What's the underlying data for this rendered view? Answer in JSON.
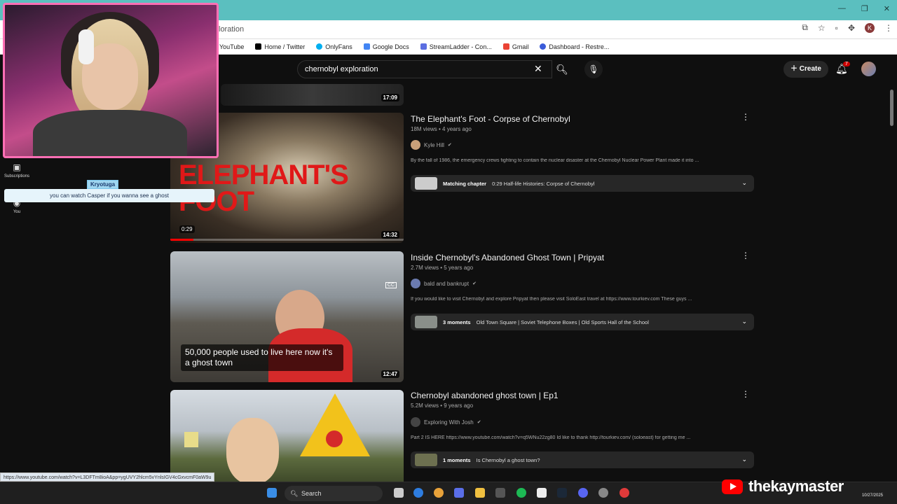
{
  "browser": {
    "url_partial": "loration",
    "bookmarks": [
      {
        "label": "YouTube",
        "color": "#ff0000"
      },
      {
        "label": "Home / Twitter",
        "color": "#000000"
      },
      {
        "label": "OnlyFans",
        "color": "#00aff0"
      },
      {
        "label": "Google Docs",
        "color": "#4285f4"
      },
      {
        "label": "StreamLadder - Con...",
        "color": "#5b6ee1"
      },
      {
        "label": "Gmail",
        "color": "#ea4335"
      },
      {
        "label": "Dashboard - Restre...",
        "color": "#3a5bd9"
      }
    ],
    "profile_initial": "K"
  },
  "header": {
    "search_value": "chernobyl exploration",
    "create_label": "Create",
    "notif_count": "7"
  },
  "sidebar": [
    {
      "label": "Subscriptions",
      "icon": "subscriptions-icon"
    },
    {
      "label": "You",
      "icon": "you-icon"
    }
  ],
  "overlay": {
    "chat_user": "Kryotuga",
    "chat_message": "you can watch Casper if you wanna see a ghost"
  },
  "results": [
    {
      "title": "The Elephant's Foot - Corpse of Chernobyl",
      "meta": "18M views • 4 years ago",
      "channel": "Kyle Hill",
      "desc": "By the fall of 1986, the emergency crews fighting to contain the nuclear disaster at the Chernobyl Nuclear Power Plant made it into ...",
      "chapter_label": "Matching chapter",
      "chapter_text": "0:29 Half-life Histories: Corpse of Chernobyl",
      "duration": "14:32",
      "progress_time": "0:29",
      "thumb_text": "ELEPHANT'S FOOT"
    },
    {
      "title": "Inside Chernobyl's Abandoned Ghost Town | Pripyat",
      "meta": "2.7M views • 5 years ago",
      "channel": "bald and bankrupt",
      "desc": "If you would like to visit Chernobyl and explore Pripyat then please visit SoloEast travel at https://www.tourkiev.com These guys ...",
      "chapter_label": "3 moments",
      "chapter_text": "Old Town Square | Soviet Telephone Boxes | Old Sports Hall of the School",
      "duration": "12:47",
      "caption": "50,000 people used to live here now it's a ghost town",
      "cc": "CC"
    },
    {
      "title": "Chernobyl abandoned ghost town | Ep1",
      "meta": "5.2M views • 9 years ago",
      "channel": "Exploring With Josh",
      "desc": "Part 2 IS HERE https://www.youtube.com/watch?v=q5WNu22zg80 Id like to thank http://tourkiev.com/ (soloeast) for getting me ...",
      "chapter_label": "1 moments",
      "chapter_text": "Is Chernobyl a ghost town?"
    }
  ],
  "top_partial_duration": "17:09",
  "status_url": "https://www.youtube.com/watch?v=L3DFTm8ioA&pp=ygUVY2hlcm5vYnlsIGV4cGxvcmF0aW9u",
  "taskbar": {
    "search_label": "Search",
    "date": "10/27/2025"
  },
  "brand": {
    "name": "thekaymaster"
  }
}
